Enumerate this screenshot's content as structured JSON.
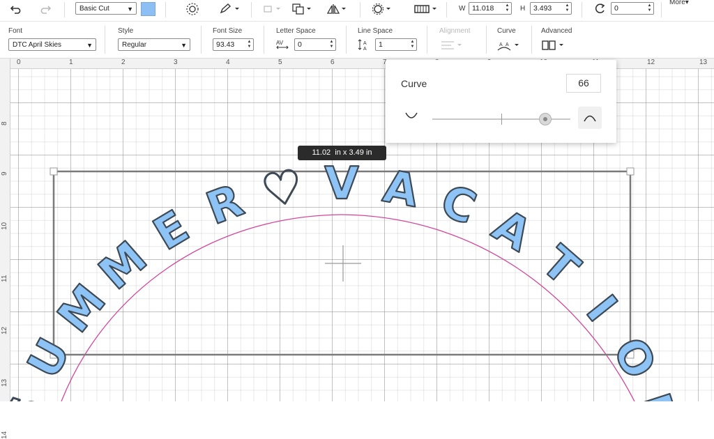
{
  "toolbar_top": {
    "undo_icon": "undo-icon",
    "redo_icon": "redo-icon",
    "operation": "Basic Cut",
    "color": "#8cc0f5",
    "width_label": "W",
    "width_value": "11.018",
    "height_label": "H",
    "height_value": "3.493",
    "rotate_value": "0",
    "more_label": "More"
  },
  "text_bar": {
    "font_label": "Font",
    "font_value": "DTC April Skies",
    "style_label": "Style",
    "style_value": "Regular",
    "font_size_label": "Font Size",
    "font_size_value": "93.43",
    "letter_space_label": "Letter Space",
    "letter_space_value": "0",
    "line_space_label": "Line Space",
    "line_space_value": "1",
    "alignment_label": "Alignment",
    "curve_label": "Curve",
    "advanced_label": "Advanced"
  },
  "ruler": {
    "top": [
      "0",
      "1",
      "2",
      "3",
      "4",
      "5",
      "6",
      "7",
      "8",
      "9",
      "10",
      "11",
      "12",
      "13"
    ],
    "left": [
      "8",
      "9",
      "10",
      "11",
      "12",
      "13",
      "14"
    ]
  },
  "curve_popup": {
    "title": "Curve",
    "value": "66",
    "slider_fraction": 0.82
  },
  "dimension_tooltip": {
    "value": "11.02",
    "rest": "in x 3.49  in"
  },
  "curved_text": {
    "letters": [
      "S",
      "U",
      "M",
      "M",
      "E",
      "R",
      "♥",
      "V",
      "A",
      "C",
      "A",
      "T",
      "I",
      "O",
      "N"
    ],
    "fill_color": "#8ec3f5",
    "outline_color": "#3d4a55",
    "guide_color": "#d2479a"
  }
}
